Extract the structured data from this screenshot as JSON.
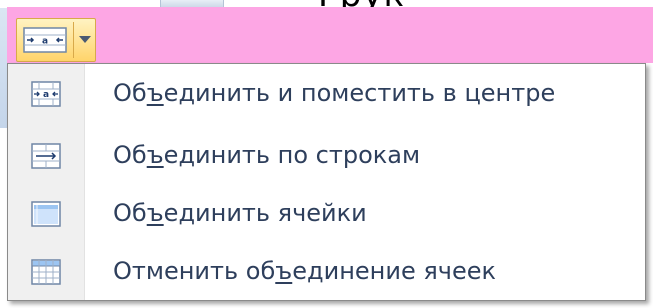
{
  "background": {
    "partial_text": "Грук"
  },
  "split_button": {
    "icon": "merge-center-icon",
    "arrow_icon": "chevron-down-icon"
  },
  "menu": {
    "items": [
      {
        "label_pre": "Об",
        "label_key": "ъ",
        "label_post": "единить и поместить в центре",
        "icon": "merge-center-icon"
      },
      {
        "label_pre": "Об",
        "label_key": "ъ",
        "label_post": "единить по строкам",
        "icon": "merge-across-icon"
      },
      {
        "label_pre": "Об",
        "label_key": "ъ",
        "label_post": "единить ячейки",
        "icon": "merge-cells-icon"
      },
      {
        "label_pre": "Отменить об",
        "label_key": "ъ",
        "label_post": "единение ячеек",
        "icon": "unmerge-cells-icon"
      }
    ]
  },
  "colors": {
    "title_bar": "#fda6e4",
    "menu_text": "#2e3f5c",
    "button_highlight": "#ffd46b"
  }
}
